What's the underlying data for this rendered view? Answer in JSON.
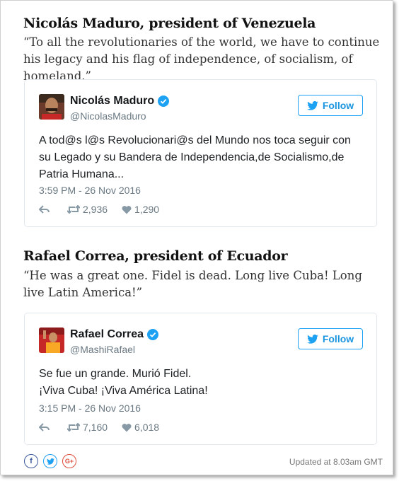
{
  "items": [
    {
      "heading": "Nicolás Maduro, president of Venezuela",
      "quote": "“To all the revolutionaries of the world, we have to continue his legacy and his flag of independence, of socialism, of homeland.”",
      "tweet": {
        "name": "Nicolás Maduro",
        "handle": "@NicolasMaduro",
        "follow_label": "Follow",
        "text": "A tod@s l@s Revolucionari@s del Mundo nos toca seguir con su Legado y su Bandera de Independencia,de Socialismo,de Patria Humana...",
        "time": "3:59 PM - 26 Nov 2016",
        "retweets": "2,936",
        "likes": "1,290"
      }
    },
    {
      "heading": "Rafael Correa, president of Ecuador",
      "quote": "“He was a great one. Fidel is dead. Long live Cuba! Long live Latin America!”",
      "tweet": {
        "name": "Rafael Correa",
        "handle": "@MashiRafael",
        "follow_label": "Follow",
        "text_line1": "Se fue un grande. Murió Fidel.",
        "text_line2": "¡Viva Cuba! ¡Viva América Latina!",
        "time": "3:15 PM - 26 Nov 2016",
        "retweets": "7,160",
        "likes": "6,018"
      }
    }
  ],
  "share": {
    "icons": [
      "facebook-icon",
      "twitter-icon",
      "google-plus-icon"
    ],
    "google_plus_label": "G+"
  },
  "updated": "Updated at 8.03am GMT",
  "colors": {
    "twitter_blue": "#1da1f2",
    "facebook": "#3b5998",
    "google_plus": "#dd4b39"
  }
}
